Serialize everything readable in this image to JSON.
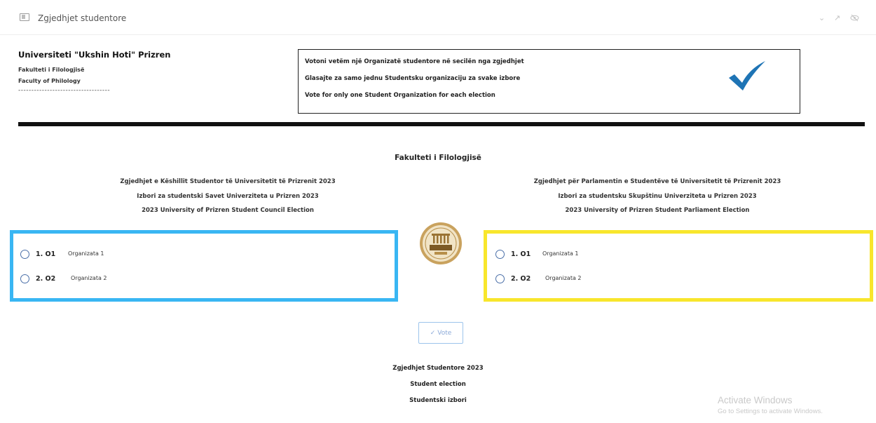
{
  "window": {
    "title": "Zgjedhjet studentore",
    "icons": [
      "window-icon",
      "chevron-down-icon",
      "expand-icon",
      "hide-icon"
    ]
  },
  "university": {
    "name": "Universiteti \"Ukshin Hoti\" Prizren",
    "faculty_sq": "Fakulteti i Filologjisë",
    "faculty_en": "Faculty of Philology",
    "dashes": "-----------------------------------"
  },
  "instructions": {
    "sq": "Votoni vetëm një Organizatë studentore në secilën nga zgjedhjet",
    "sr": "Glasajte za samo jednu Studentsku organizaciju za svake izbore",
    "en": "Vote for only one Student Organization for each election",
    "check_color": "#1e74b5"
  },
  "faculty_title": "Fakulteti i Filologjisë",
  "council": {
    "heading_sq": "Zgjedhjet e Këshillit Studentor të Universitetit të Prizrenit 2023",
    "heading_sr": "Izbori za studentski Savet Univerziteta u Prizren 2023",
    "heading_en": "2023 University of Prizren Student Council Election",
    "border_color": "#39b6f3",
    "options": [
      {
        "num": "1. O1",
        "org": "Organizata 1"
      },
      {
        "num": "2. O2",
        "org": "Organizata 2"
      }
    ]
  },
  "parliament": {
    "heading_sq": "Zgjedhjet për Parlamentin e Studentëve të Universitetit të Prizrenit 2023",
    "heading_sr": "Izbori za studentsku Skupštinu Univerziteta u Prizren 2023",
    "heading_en": "2023 University of Prizren Student Parliament Election",
    "border_color": "#f8e62c",
    "options": [
      {
        "num": "1. O1",
        "org": "Organizata 1"
      },
      {
        "num": "2. O2",
        "org": "Organizata 2"
      }
    ]
  },
  "vote_button": {
    "label": "Vote",
    "icon": "check-icon"
  },
  "footer": {
    "line1": "Zgjedhjet Studentore 2023",
    "line2": "Student election",
    "line3": "Studentski izbori"
  },
  "watermark": {
    "title": "Activate Windows",
    "subtitle": "Go to Settings to activate Windows."
  }
}
